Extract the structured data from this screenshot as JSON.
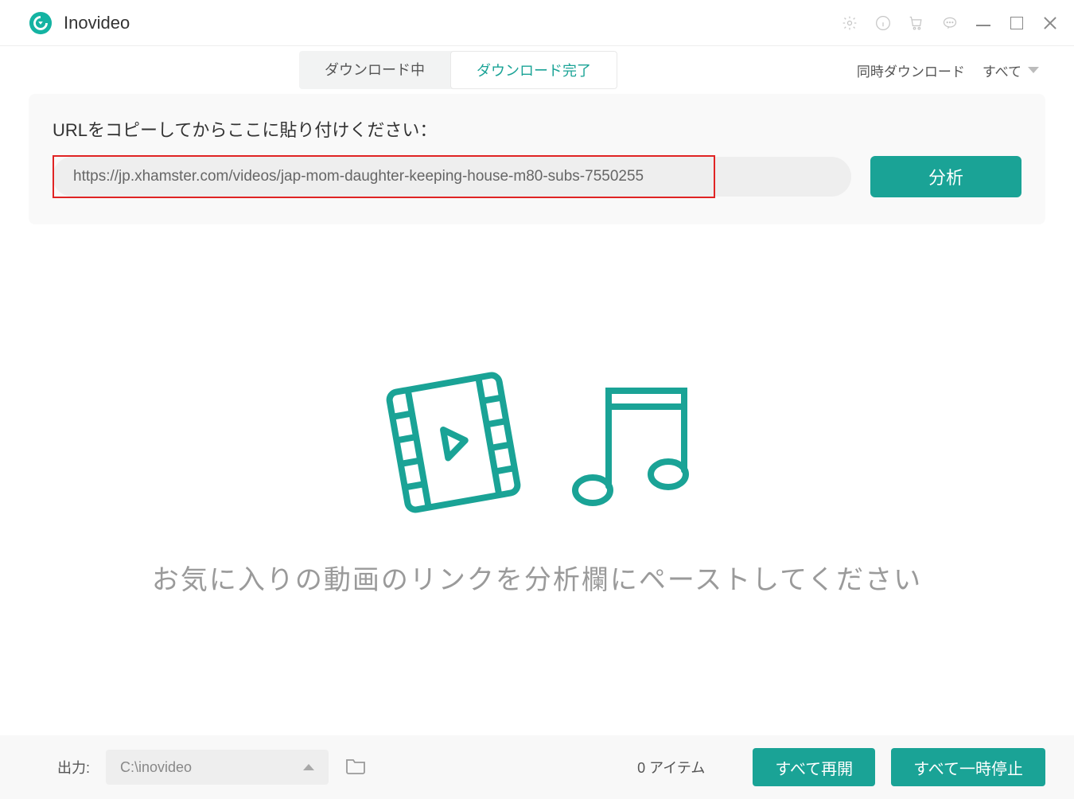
{
  "app": {
    "title": "Inovideo"
  },
  "tabs": {
    "downloading": "ダウンロード中",
    "completed": "ダウンロード完了"
  },
  "concurrent": {
    "label": "同時ダウンロード",
    "value": "すべて"
  },
  "url_panel": {
    "label": "URLをコピーしてからここに貼り付けください：",
    "input_value": "https://jp.xhamster.com/videos/jap-mom-daughter-keeping-house-m80-subs-7550255",
    "analyze": "分析"
  },
  "empty": {
    "message": "お気に入りの動画のリンクを分析欄にペーストしてください"
  },
  "footer": {
    "output_label": "出力:",
    "output_path": "C:\\inovideo",
    "item_count": "0 アイテム",
    "resume_all": "すべて再開",
    "pause_all": "すべて一時停止"
  },
  "icons": {
    "logo": "app-logo-icon",
    "settings": "gear-icon",
    "info": "info-icon",
    "cart": "cart-icon",
    "chat": "chat-icon"
  }
}
